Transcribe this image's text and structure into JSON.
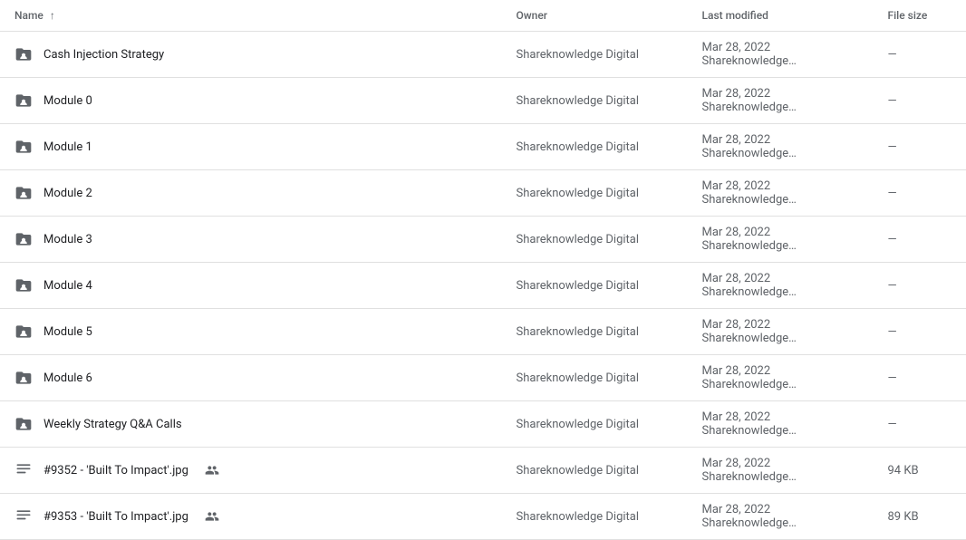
{
  "table": {
    "headers": {
      "name": "Name",
      "owner": "Owner",
      "modified": "Last modified",
      "size": "File size"
    },
    "rows": [
      {
        "id": "cash-injection",
        "name": "Cash Injection Strategy",
        "type": "shared-folder",
        "owner": "Shareknowledge Digital",
        "modified": "Mar 28, 2022",
        "modifiedExtra": "Shareknowledge…",
        "size": "—",
        "hasPeopleBadge": false
      },
      {
        "id": "module-0",
        "name": "Module 0",
        "type": "shared-folder",
        "owner": "Shareknowledge Digital",
        "modified": "Mar 28, 2022",
        "modifiedExtra": "Shareknowledge…",
        "size": "—",
        "hasPeopleBadge": false
      },
      {
        "id": "module-1",
        "name": "Module 1",
        "type": "shared-folder",
        "owner": "Shareknowledge Digital",
        "modified": "Mar 28, 2022",
        "modifiedExtra": "Shareknowledge…",
        "size": "—",
        "hasPeopleBadge": false
      },
      {
        "id": "module-2",
        "name": "Module 2",
        "type": "shared-folder",
        "owner": "Shareknowledge Digital",
        "modified": "Mar 28, 2022",
        "modifiedExtra": "Shareknowledge…",
        "size": "—",
        "hasPeopleBadge": false
      },
      {
        "id": "module-3",
        "name": "Module 3",
        "type": "shared-folder",
        "owner": "Shareknowledge Digital",
        "modified": "Mar 28, 2022",
        "modifiedExtra": "Shareknowledge…",
        "size": "—",
        "hasPeopleBadge": false
      },
      {
        "id": "module-4",
        "name": "Module 4",
        "type": "shared-folder",
        "owner": "Shareknowledge Digital",
        "modified": "Mar 28, 2022",
        "modifiedExtra": "Shareknowledge…",
        "size": "—",
        "hasPeopleBadge": false
      },
      {
        "id": "module-5",
        "name": "Module 5",
        "type": "shared-folder",
        "owner": "Shareknowledge Digital",
        "modified": "Mar 28, 2022",
        "modifiedExtra": "Shareknowledge…",
        "size": "—",
        "hasPeopleBadge": false
      },
      {
        "id": "module-6",
        "name": "Module 6",
        "type": "shared-folder",
        "owner": "Shareknowledge Digital",
        "modified": "Mar 28, 2022",
        "modifiedExtra": "Shareknowledge…",
        "size": "—",
        "hasPeopleBadge": false
      },
      {
        "id": "weekly-strategy",
        "name": "Weekly Strategy Q&A Calls",
        "type": "shared-folder",
        "owner": "Shareknowledge Digital",
        "modified": "Mar 28, 2022",
        "modifiedExtra": "Shareknowledge…",
        "size": "—",
        "hasPeopleBadge": false
      },
      {
        "id": "file-9352",
        "name": "#9352 - 'Built To Impact'.jpg",
        "type": "image",
        "owner": "Shareknowledge Digital",
        "modified": "Mar 28, 2022",
        "modifiedExtra": "Shareknowledge…",
        "size": "94 KB",
        "hasPeopleBadge": true
      },
      {
        "id": "file-9353",
        "name": "#9353 - 'Built To Impact'.jpg",
        "type": "image",
        "owner": "Shareknowledge Digital",
        "modified": "Mar 28, 2022",
        "modifiedExtra": "Shareknowledge…",
        "size": "89 KB",
        "hasPeopleBadge": true
      }
    ]
  }
}
